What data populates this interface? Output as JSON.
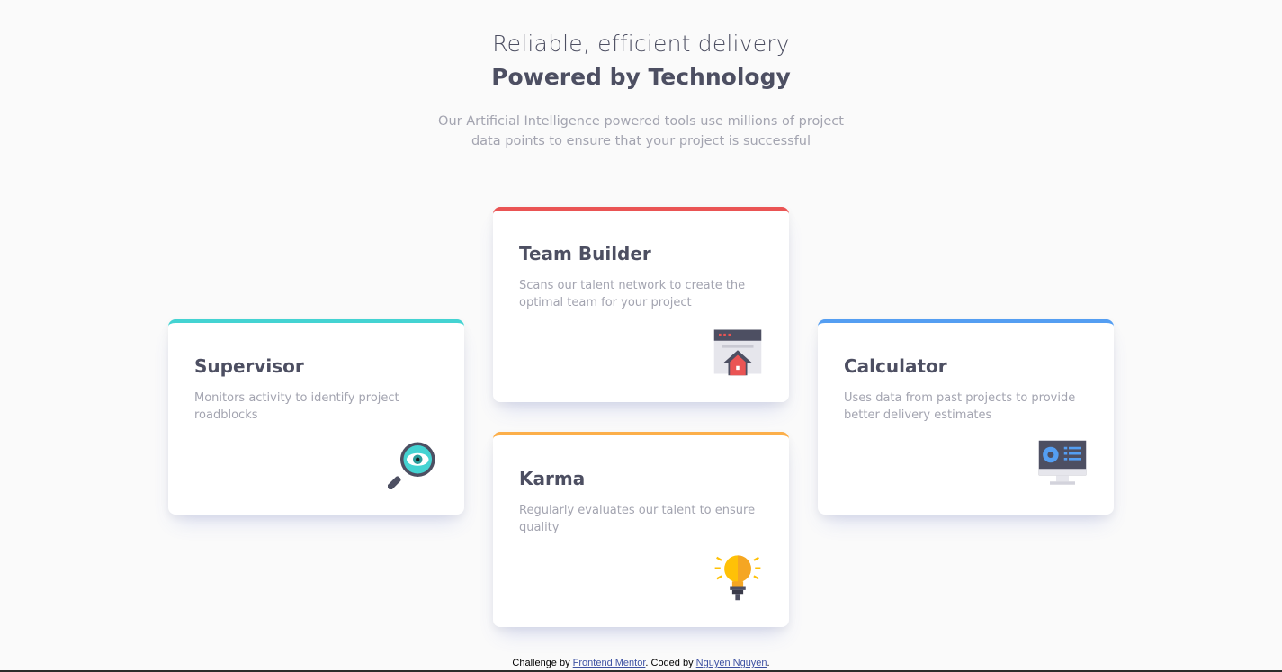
{
  "header": {
    "line1": "Reliable, efficient delivery",
    "line2": "Powered by Technology",
    "intro": "Our Artificial Intelligence powered tools use millions of project data points to ensure that your project is successful"
  },
  "cards": [
    {
      "title": "Supervisor",
      "text": "Monitors activity to identify project roadblocks",
      "accent": "#44d3d2",
      "icon": "supervisor-icon"
    },
    {
      "title": "Team Builder",
      "text": "Scans our talent network to create the optimal team for your project",
      "accent": "#ea5454",
      "icon": "team-builder-icon"
    },
    {
      "title": "Karma",
      "text": "Regularly evaluates our talent to ensure quality",
      "accent": "#fcaf4a",
      "icon": "karma-icon"
    },
    {
      "title": "Calculator",
      "text": "Uses data from past projects to provide better delivery estimates",
      "accent": "#549ef2",
      "icon": "calculator-icon"
    }
  ],
  "footer": {
    "prefix": "Challenge by ",
    "link1": "Frontend Mentor",
    "middle": ". Coded by ",
    "link2": "Nguyen Nguyen",
    "suffix": "."
  }
}
